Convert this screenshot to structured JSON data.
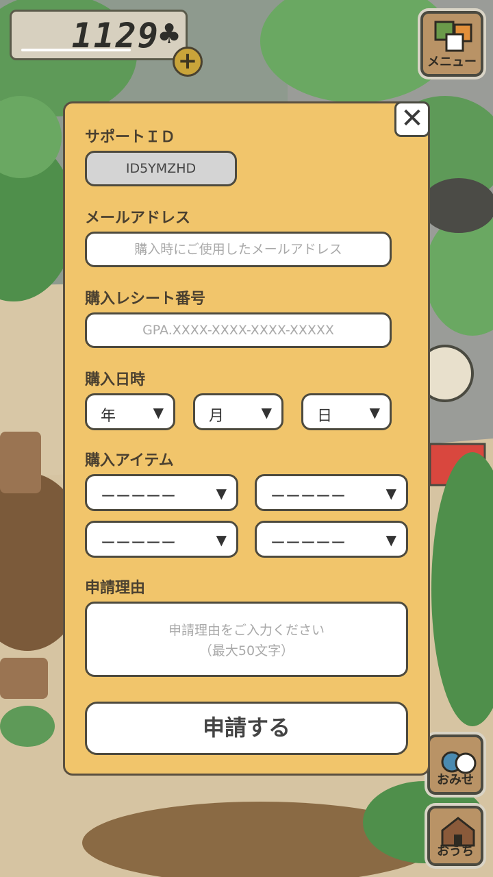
{
  "hud": {
    "coins": "1129",
    "clover_icon": "♣",
    "plus_label": "+"
  },
  "side_buttons": {
    "menu_label": "メニュー",
    "shop_label": "おみせ",
    "home_label": "おうち"
  },
  "dialog": {
    "close_label": "✕",
    "support_id_label": "サポートＩＤ",
    "support_id_value": "ID5YMZHD",
    "email_label": "メールアドレス",
    "email_placeholder": "購入時にご使用したメールアドレス",
    "receipt_label": "購入レシート番号",
    "receipt_placeholder": "GPA.XXXX-XXXX-XXXX-XXXXX",
    "date_label": "購入日時",
    "date_selects": [
      {
        "value": "年"
      },
      {
        "value": "月"
      },
      {
        "value": "日"
      }
    ],
    "item_label": "購入アイテム",
    "item_selects": [
      {
        "value": "ーーーーー"
      },
      {
        "value": "ーーーーー"
      },
      {
        "value": "ーーーーー"
      },
      {
        "value": "ーーーーー"
      }
    ],
    "reason_label": "申請理由",
    "reason_placeholder_line1": "申請理由をご入力ください",
    "reason_placeholder_line2": "（最大50文字）",
    "submit_label": "申請する",
    "dropdown_arrow": "▼"
  },
  "colors": {
    "panel": "#f1c56b",
    "border": "#4d4a3e",
    "wood": "#b99366"
  }
}
